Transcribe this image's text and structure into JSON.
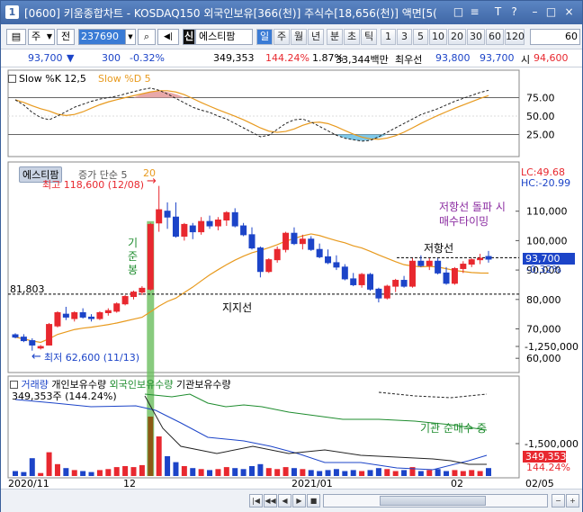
{
  "window": {
    "title_icon": "1",
    "title": "[0600] 키움종합차트 - KOSDAQ150 외국인보유[366(천)] 주식수[18,656(천)] 액면[5(",
    "controls": [
      "□",
      "≡",
      "T",
      "?",
      "–",
      "□",
      "×"
    ]
  },
  "toolbar": {
    "code": "",
    "type1": "주",
    "type2": "전",
    "input_value": "237690",
    "stock_badge": "신",
    "stock_name": "에스티팜",
    "periods": [
      "일",
      "주",
      "월",
      "년",
      "분",
      "초",
      "틱"
    ],
    "selected_period": "일",
    "nums": [
      "1",
      "3",
      "5",
      "10",
      "20",
      "30",
      "60",
      "120"
    ],
    "count": "60"
  },
  "quote": {
    "price": "93,700",
    "arrow": "▼",
    "change": "300",
    "pct": "-0.32%",
    "volume": "349,353",
    "vol_pct": "144.24%",
    "turnover": "1.87%",
    "amount": "33,344백만",
    "best_label": "최우선",
    "best_bid": "93,800",
    "best_ask": "93,700",
    "open_label": "시",
    "open": "94,600"
  },
  "colors": {
    "up": "#e8282f",
    "down": "#1c44c8",
    "ma": "#e89a1e",
    "support": "#000000",
    "highlight_green": "#6abe5e",
    "highlight_brown": "#8b5a14",
    "annot_purple": "#8a2aa0",
    "annot_green": "#1e8c2e"
  },
  "stoch": {
    "label_k": "Slow %K 12,5",
    "label_d": "Slow %D 5",
    "ticks": [
      "75.00",
      "50.00",
      "25.00"
    ]
  },
  "price_panel": {
    "name_tag": "에스티팜",
    "ma_label": "증가 단순 5",
    "ma_period": "20",
    "lc": "LC:49.68",
    "hc": "HC:-20.99",
    "high_label": "최고 118,600 (12/08)",
    "low_label": "최저 62,600 (11/13)",
    "support_value": "81,803",
    "support_text": "지지선",
    "resist_text": "저항선",
    "annot_break": "저항선 돌파 시",
    "annot_break2": "매수타이밍",
    "annot_base": "기준봉",
    "cur_price": "93,700",
    "cur_pct": "-0.32%",
    "ticks": [
      "110,000",
      "100,000",
      "90,000",
      "80,000",
      "70,000",
      "60,000"
    ]
  },
  "volume_panel": {
    "legend": [
      "거래량",
      "개인보유수량",
      "외국인보유수량",
      "기관보유수량"
    ],
    "vol_text": "349,353주 (144.24%)",
    "ticks": [
      "-1,250,000",
      "-1,500,000"
    ],
    "badge1": "349,353",
    "badge2": "144.24%",
    "annot": "기관 순매수 중"
  },
  "x_axis": [
    "2020/11",
    "12",
    "2021/01",
    "02",
    "02/05"
  ],
  "chart_data": {
    "type": "candlestick",
    "candles": [
      [
        68,
        68.5,
        66.8,
        67.2
      ],
      [
        67.2,
        68.2,
        65.5,
        66.0
      ],
      [
        66,
        66.8,
        62.6,
        64.5
      ],
      [
        63.5,
        64.5,
        63,
        64
      ],
      [
        64.5,
        72,
        64.5,
        71.5
      ],
      [
        71,
        76,
        70.5,
        75.5
      ],
      [
        75,
        77.5,
        73,
        74
      ],
      [
        73.5,
        76,
        72.5,
        75.5
      ],
      [
        75.5,
        77,
        73.5,
        74
      ],
      [
        74,
        75,
        72.5,
        73.5
      ],
      [
        73.5,
        76,
        73,
        75.5
      ],
      [
        75.5,
        77,
        74.5,
        76.2
      ],
      [
        76,
        79,
        75.5,
        78.5
      ],
      [
        78.5,
        81.5,
        78,
        81
      ],
      [
        81,
        83,
        80,
        82.5
      ],
      [
        82.5,
        84.5,
        81.5,
        83.8
      ],
      [
        83.5,
        106,
        83,
        105.5
      ],
      [
        106,
        118.6,
        103,
        110.5
      ],
      [
        110,
        113,
        104,
        108
      ],
      [
        108,
        113,
        101,
        101.5
      ],
      [
        101.5,
        106,
        100,
        105.5
      ],
      [
        105,
        106,
        100.5,
        103
      ],
      [
        103,
        108,
        102,
        106.5
      ],
      [
        106.5,
        108.5,
        104,
        105
      ],
      [
        105,
        108,
        103.5,
        107
      ],
      [
        107,
        110,
        105,
        109.5
      ],
      [
        109.5,
        111,
        104.5,
        105
      ],
      [
        105,
        106,
        101.5,
        102
      ],
      [
        102,
        104.5,
        97,
        97.5
      ],
      [
        97.5,
        98,
        87.5,
        89.5
      ],
      [
        89.5,
        94,
        89,
        93.5
      ],
      [
        93.5,
        98,
        92.5,
        97
      ],
      [
        97,
        103,
        96,
        102.5
      ],
      [
        102.5,
        104.5,
        98.5,
        99
      ],
      [
        99,
        102,
        97,
        100.5
      ],
      [
        100.5,
        101.5,
        96.5,
        97
      ],
      [
        97,
        99,
        94,
        94.5
      ],
      [
        94.5,
        97,
        92,
        92.5
      ],
      [
        92.5,
        95,
        90,
        91
      ],
      [
        91,
        92,
        86.5,
        87
      ],
      [
        87,
        89,
        84.5,
        85
      ],
      [
        85,
        89,
        84,
        88.5
      ],
      [
        88.5,
        89,
        83,
        83.5
      ],
      [
        83.5,
        84,
        79,
        80.5
      ],
      [
        80.5,
        85,
        80,
        84.5
      ],
      [
        84.5,
        87,
        82.5,
        86.5
      ],
      [
        86.5,
        88,
        84,
        84.5
      ],
      [
        84.5,
        94,
        84,
        93
      ],
      [
        93,
        95,
        91,
        91.5
      ],
      [
        91.5,
        94,
        90,
        93
      ],
      [
        93,
        94,
        88.5,
        89
      ],
      [
        89,
        91,
        85,
        85.5
      ],
      [
        85.5,
        91,
        85,
        90.5
      ],
      [
        90.5,
        93,
        89,
        92
      ],
      [
        92,
        94,
        91,
        93.5
      ],
      [
        93.5,
        95.5,
        92,
        94
      ],
      [
        94.6,
        96.5,
        92.5,
        93.7
      ]
    ]
  }
}
